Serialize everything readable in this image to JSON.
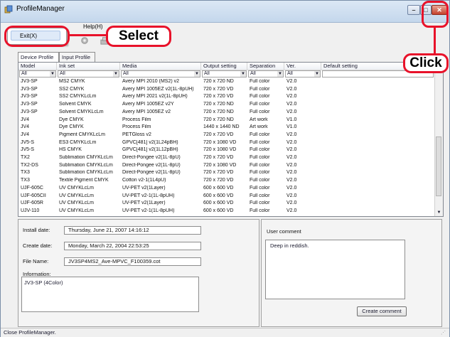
{
  "window": {
    "title": "ProfileManager"
  },
  "menu": {
    "file_fragment": "",
    "help_label": "Help(H)"
  },
  "dropdown": {
    "exit_label": "Exit(X)"
  },
  "annotations": {
    "select_label": "Select",
    "click_label": "Click",
    "color": "#e8122a"
  },
  "tabs": [
    {
      "label": "Device Profile"
    },
    {
      "label": "Input Profile"
    }
  ],
  "table": {
    "columns": [
      "Model",
      "Ink set",
      "Media",
      "Output setting",
      "Separation",
      "Ver.",
      "Default setting"
    ],
    "filters": [
      "All",
      "All",
      "All",
      "All",
      "All",
      "All",
      ""
    ],
    "rows": [
      [
        "JV3-SP",
        "MS2 CMYK",
        "Avery MPI 2010 (MS2) v2",
        "720 x 720 ND",
        "Full color",
        "V2.0"
      ],
      [
        "JV3-SP",
        "SS2 CMYK",
        "Avery MPI 1005EZ v2(1L-8pUH)",
        "720 x 720 VD",
        "Full color",
        "V2.0"
      ],
      [
        "JV3-SP",
        "SS2 CMYKLcLm",
        "Avery MPI 2021 v2(1L-8pUH)",
        "720 x 720 VD",
        "Full color",
        "V2.0"
      ],
      [
        "JV3-SP",
        "Solvent CMYK",
        "Avery MPI 1005EZ v2Y",
        "720 x 720 ND",
        "Full color",
        "V2.0"
      ],
      [
        "JV3-SP",
        "Solvent CMYKLcLm",
        "Avery MPI 1005EZ v2",
        "720 x 720 ND",
        "Full color",
        "V2.0"
      ],
      [
        "JV4",
        "Dye CMYK",
        "Process Film",
        "720 x 720 ND",
        "Art work",
        "V1.0"
      ],
      [
        "JV4",
        "Dye CMYK",
        "Process Film",
        "1440 x 1440 ND",
        "Art work",
        "V1.0"
      ],
      [
        "JV4",
        "Pigment CMYKLcLm",
        "PETGloss v2",
        "720 x 720 VD",
        "Full color",
        "V2.0"
      ],
      [
        "JV5-S",
        "ES3 CMYKLcLm",
        "GPVC[481] v2(1L24pBH)",
        "720 x 1080 VD",
        "Full color",
        "V2.0"
      ],
      [
        "JV5-S",
        "HS CMYK",
        "GPVC[481] v2(1L12pBH)",
        "720 x 1080 VD",
        "Full color",
        "V2.0"
      ],
      [
        "TX2",
        "Sublimation CMYKLcLm",
        "Direct-Pongee v2(1L-8pU)",
        "720 x 720 VD",
        "Full color",
        "V2.0"
      ],
      [
        "TX2-DS",
        "Sublimation CMYKLcLm",
        "Direct-Pongee v2(1L-8pU)",
        "720 x 1080 VD",
        "Full color",
        "V2.0"
      ],
      [
        "TX3",
        "Sublimation CMYKLcLm",
        "Direct-Pongee v2(1L-8pU)",
        "720 x 720 VD",
        "Full color",
        "V2.0"
      ],
      [
        "TX3",
        "Textile Pigment CMYK",
        "Cotton v2-1(1L4pU)",
        "720 x 720 VD",
        "Full color",
        "V2.0"
      ],
      [
        "UJF-605C",
        "UV CMYKLcLm",
        "UV-PET v2(1Layer)",
        "600 x 600 VD",
        "Full color",
        "V2.0"
      ],
      [
        "UJF-605CII",
        "UV CMYKLcLm",
        "UV-PET v2-1(1L-8pUH)",
        "600 x 600 VD",
        "Full color",
        "V2.0"
      ],
      [
        "UJF-605R",
        "UV CMYKLcLm",
        "UV-PET v2(1Layer)",
        "600 x 600 VD",
        "Full color",
        "V2.0"
      ],
      [
        "UJV-110",
        "UV CMYKLcLm",
        "UV-PET v2-1(1L-8pUH)",
        "600 x 600 VD",
        "Full color",
        "V2.0"
      ]
    ]
  },
  "details": {
    "install_date_label": "Install date:",
    "install_date": "Thursday, June 21, 2007 14:16:12",
    "create_date_label": "Create date:",
    "create_date": "Monday, March 22, 2004 22:53:25",
    "file_name_label": "File Name:",
    "file_name": "JV3SP4MS2_Ave-MPVC_F100359.cot",
    "information_label": "Information:",
    "information": "JV3-SP (4Color)"
  },
  "comment": {
    "label": "User comment",
    "text": "Deep in reddish.",
    "button_label": "Create comment"
  },
  "status": {
    "text": "Close ProfileManager."
  }
}
